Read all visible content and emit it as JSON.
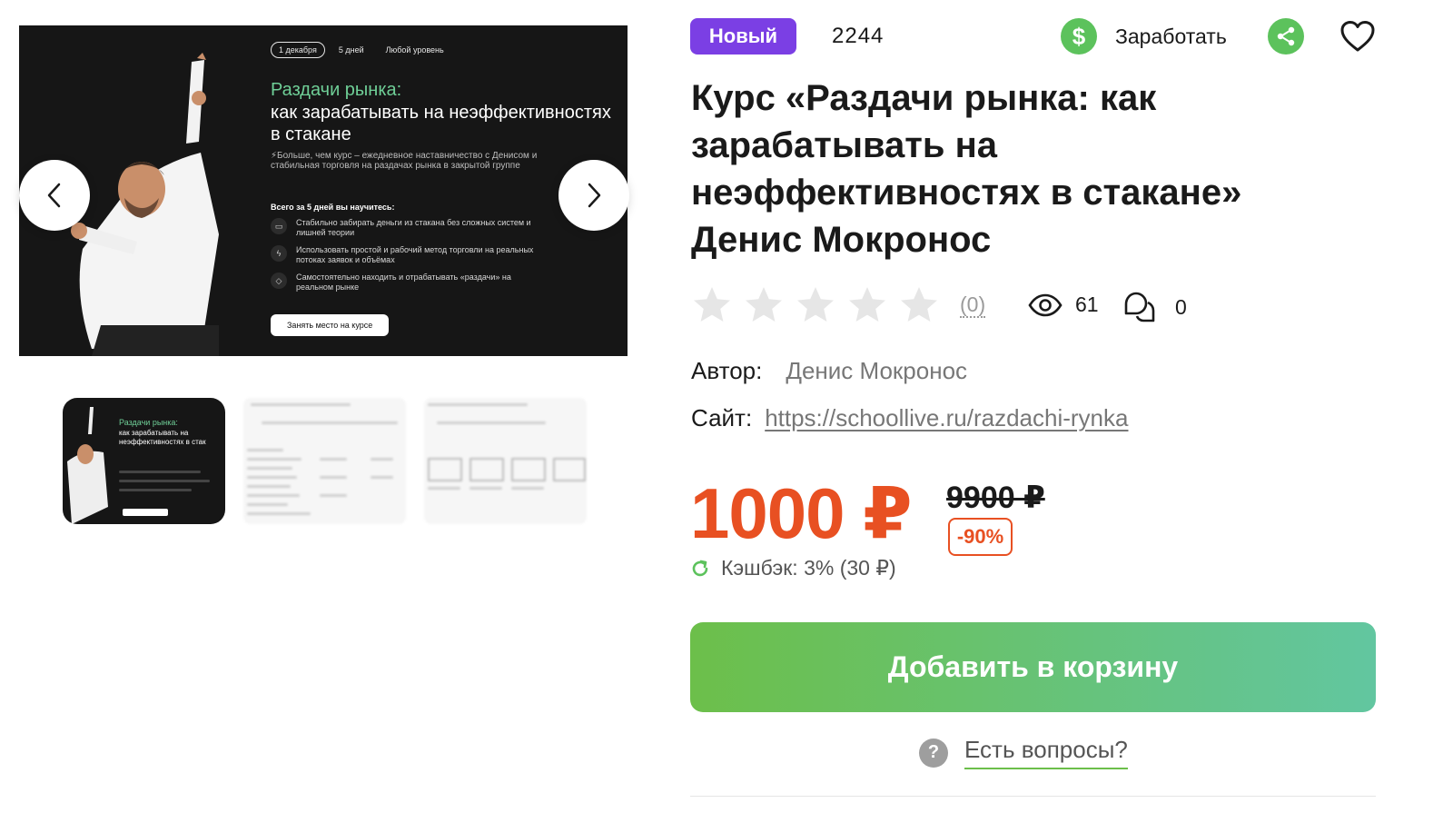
{
  "gallery": {
    "banner": {
      "chips": [
        "1 декабря",
        "5 дней",
        "Любой уровень"
      ],
      "title_green": "Раздачи рынка:",
      "title_white": "как зарабатывать на неэффективностях в стакане",
      "description": "⚡Больше, чем курс – ежедневное наставничество с Денисом и стабильная торговля на раздачах рынка в закрытой группе",
      "learn_heading": "Всего за 5 дней вы научитесь:",
      "bullets": [
        "Стабильно забирать деньги из стакана без сложных систем и лишней теории",
        "Использовать простой и рабочий метод торговли на реальных потоках заявок и объёмах",
        "Самостоятельно находить и отрабатывать «раздачи» на реальном рынке"
      ],
      "cta": "Занять место на курсе"
    },
    "thumb_active": {
      "title_green": "Раздачи рынка:",
      "title_white": "как зарабатывать на неэффективностях в стак"
    }
  },
  "product": {
    "badge": "Новый",
    "id": "2244",
    "earn_label": "Заработать",
    "title": "Курс «Раздачи рынка: как зарабатывать на неэффективностях в стакане» Денис Мокронос",
    "rating": {
      "stars": 0,
      "max": 5,
      "count": "(0)"
    },
    "views": "61",
    "comments": "0",
    "author_label": "Автор:",
    "author": "Денис Мокронос",
    "site_label": "Сайт:",
    "site": "https://schoollive.ru/razdachi-rynka",
    "price": "1000 ₽",
    "old_price": "9900 ₽",
    "discount": "-90%",
    "cashback": "Кэшбэк: 3% (30 ₽)",
    "cart_button": "Добавить в корзину",
    "faq": "Есть вопросы?"
  },
  "colors": {
    "badge": "#7b3fe4",
    "price": "#e85022",
    "accent_green": "#5cc25c",
    "banner_green": "#6fcf97"
  },
  "icons": [
    "chevron-left-icon",
    "chevron-right-icon",
    "dollar-icon",
    "share-icon",
    "heart-icon",
    "star-icon",
    "eye-icon",
    "comments-icon",
    "refresh-icon",
    "question-icon"
  ]
}
